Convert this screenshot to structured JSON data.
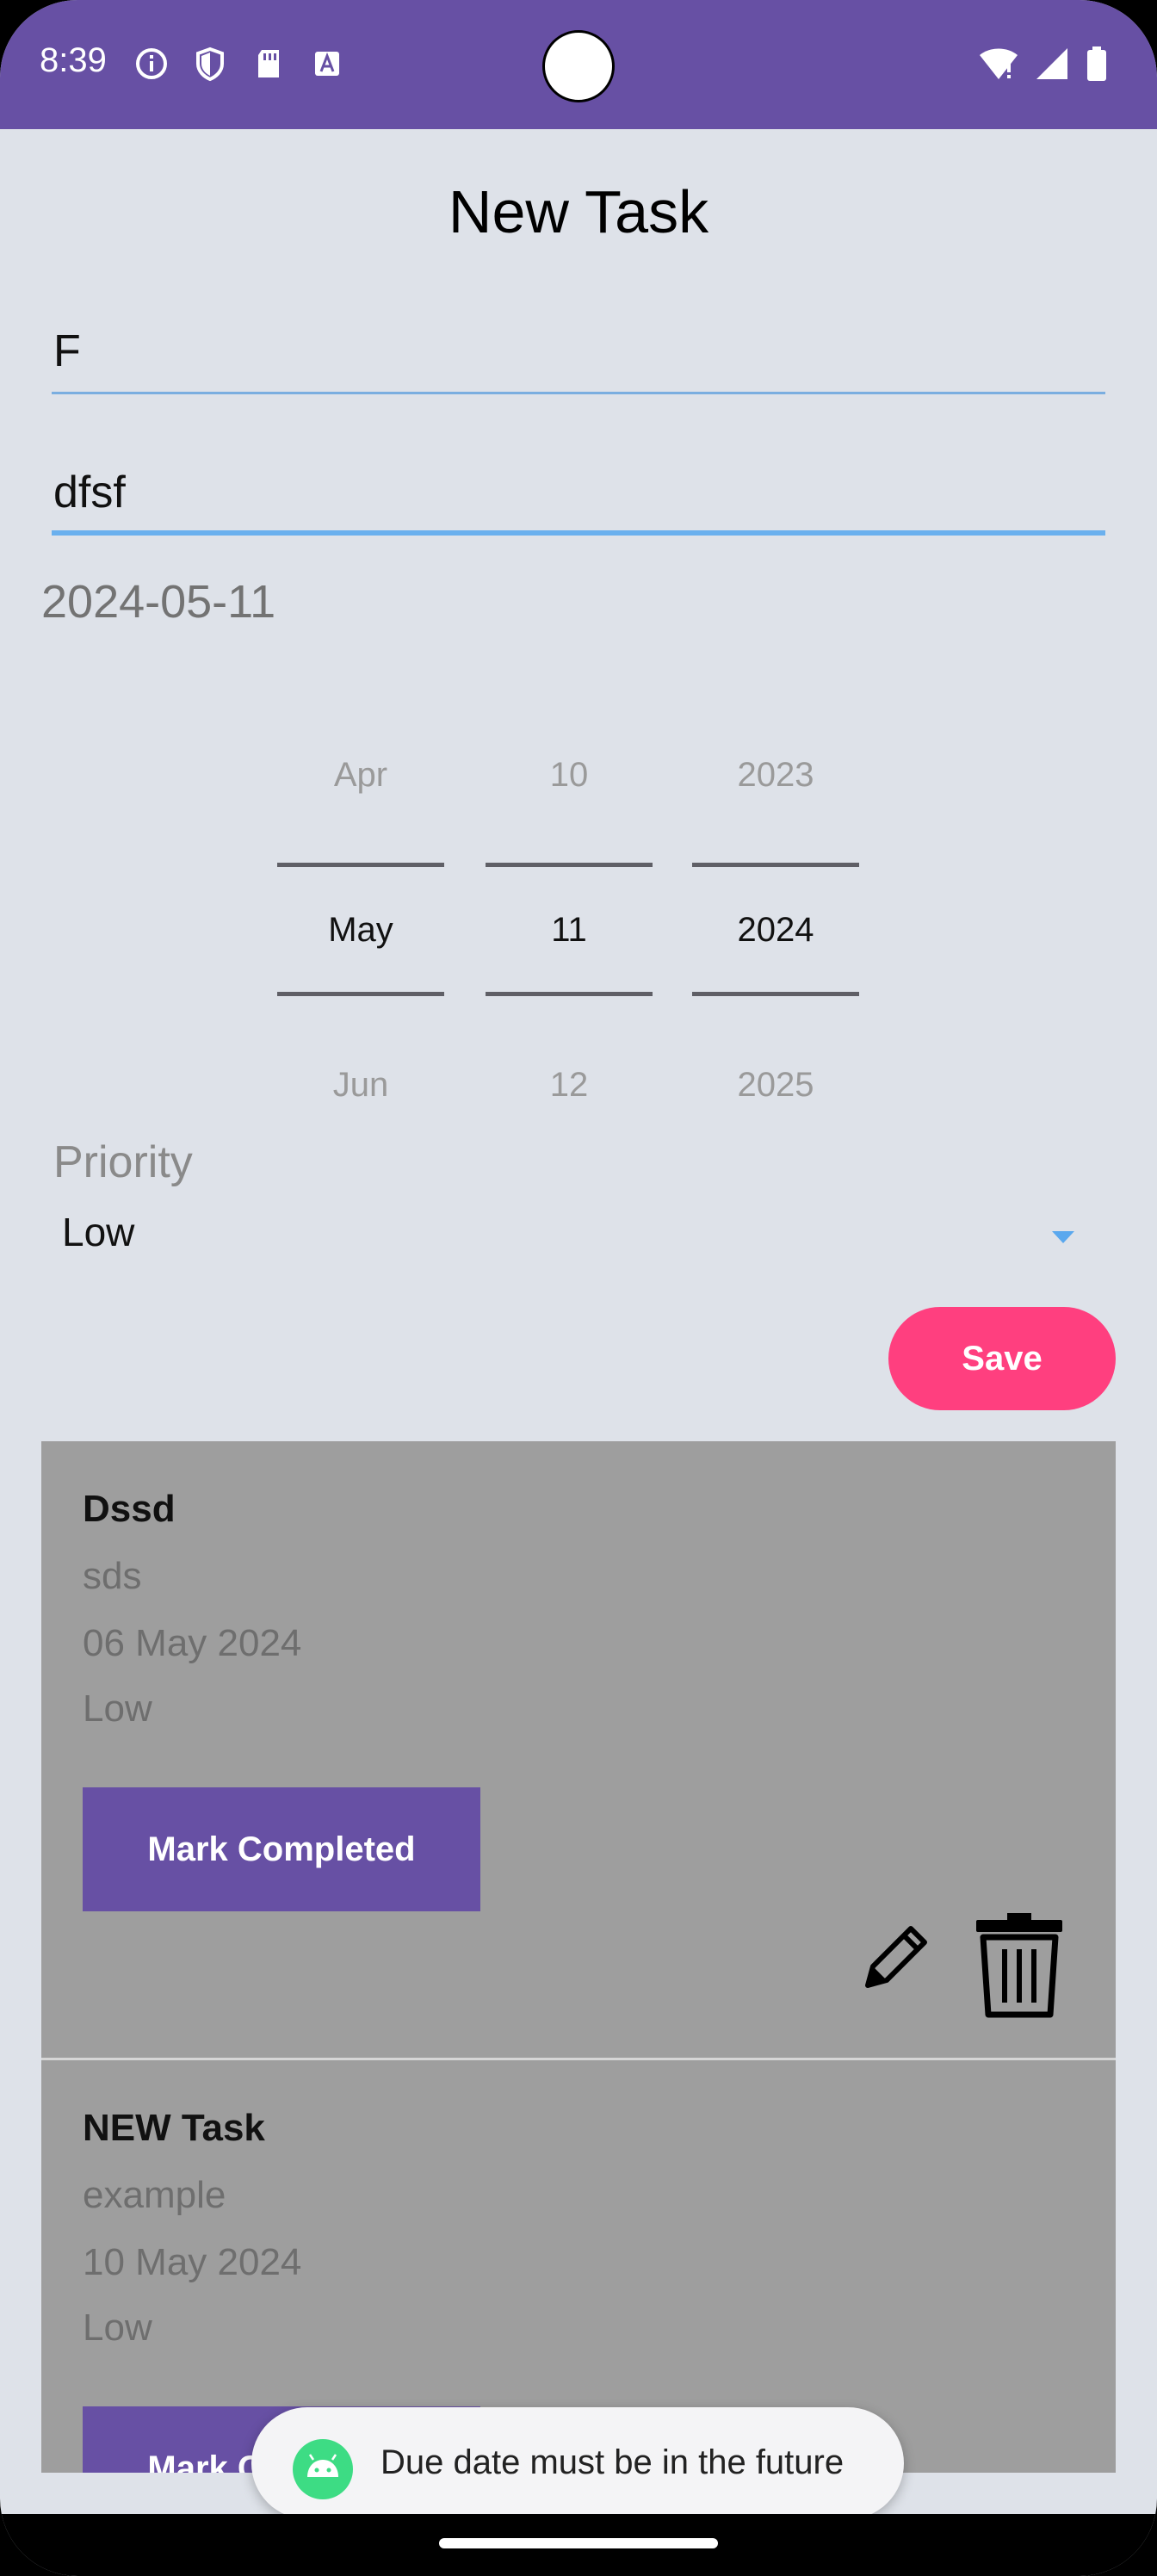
{
  "status_bar": {
    "time": "8:39",
    "icons_left": [
      "info-icon",
      "shield-icon",
      "sd-card-icon",
      "font-icon"
    ],
    "icons_right": [
      "wifi-icon",
      "signal-icon",
      "battery-icon"
    ],
    "background_color": "#6750a4"
  },
  "form": {
    "page_title": "New Task",
    "title_value": "F",
    "description_value": "dfsf",
    "selected_date": "2024-05-11",
    "date_picker": {
      "month": {
        "prev": "Apr",
        "selected": "May",
        "next": "Jun"
      },
      "day": {
        "prev": "10",
        "selected": "11",
        "next": "12"
      },
      "year": {
        "prev": "2023",
        "selected": "2024",
        "next": "2025"
      }
    },
    "priority_label": "Priority",
    "priority_value": "Low",
    "save_label": "Save",
    "save_color": "#ff3f7f"
  },
  "tasks": [
    {
      "title": "Dssd",
      "description": "sds",
      "due_date": "06 May 2024",
      "priority": "Low",
      "action_label": "Mark Completed"
    },
    {
      "title": "NEW Task",
      "description": "example",
      "due_date": "10 May 2024",
      "priority": "Low",
      "action_label": "Mark Completed"
    }
  ],
  "toast": {
    "icon": "android-icon",
    "message": "Due date must be in the future"
  }
}
